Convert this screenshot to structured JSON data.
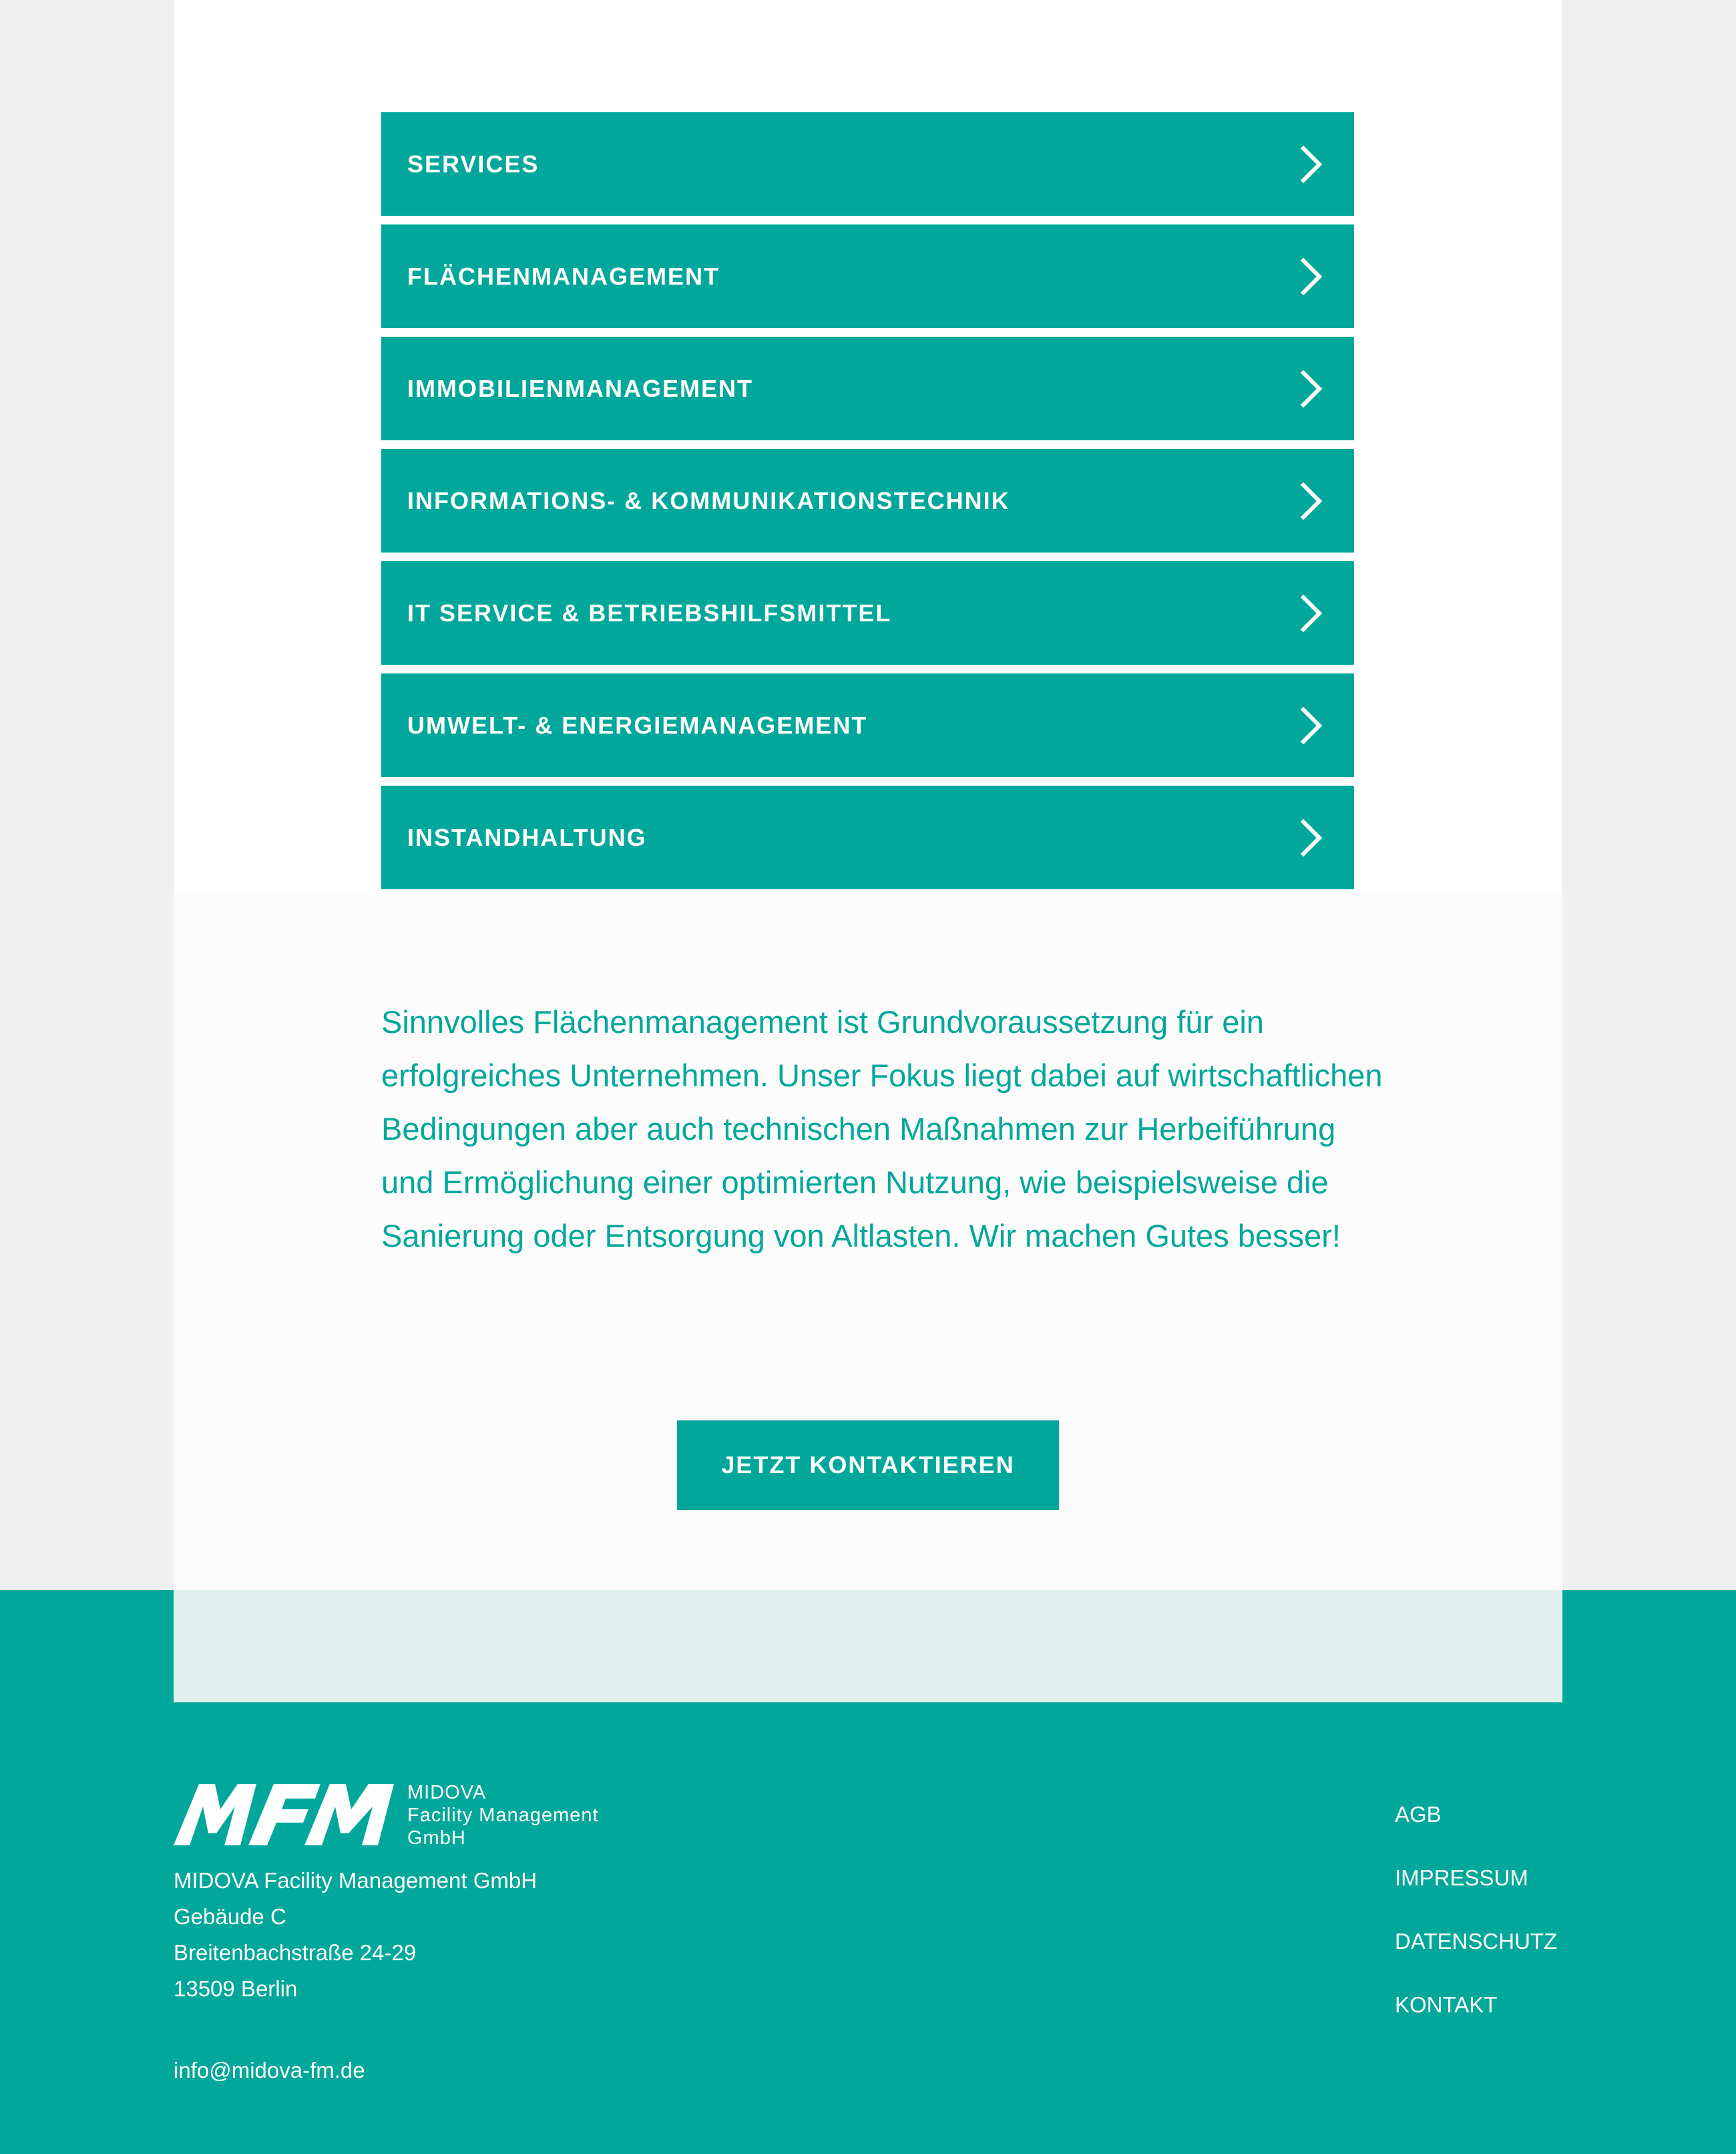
{
  "menu": {
    "items": [
      {
        "label": "SERVICES",
        "icon": "chevron-right-icon"
      },
      {
        "label": "FLÄCHENMANAGEMENT",
        "icon": "chevron-right-icon"
      },
      {
        "label": "IMMOBILIENMANAGEMENT",
        "icon": "chevron-right-icon"
      },
      {
        "label": "INFORMATIONS- & KOMMUNIKATIONSTECHNIK",
        "icon": "chevron-right-icon"
      },
      {
        "label": "IT SERVICE & BETRIEBSHILFSMITTEL",
        "icon": "chevron-right-icon"
      },
      {
        "label": "UMWELT- & ENERGIEMANAGEMENT",
        "icon": "chevron-right-icon"
      },
      {
        "label": "INSTANDHALTUNG",
        "icon": "chevron-right-icon"
      }
    ]
  },
  "intro": {
    "text": "Sinnvolles Flächenmanagement ist Grundvoraussetzung für ein erfolgreiches Unternehmen. Unser Fokus liegt dabei auf wirtschaftlichen Bedingungen aber auch technischen Maßnahmen zur Herbeiführung und Ermöglichung einer optimierten Nutzung, wie beispielsweise die Sanierung oder Entsorgung von Altlasten. Wir machen Gutes besser!",
    "cta_label": "JETZT KONTAKTIEREN"
  },
  "footer": {
    "logo": {
      "mark": "MFM",
      "line1": "MIDOVA",
      "line2": "Facility Management",
      "line3": "GmbH"
    },
    "address": {
      "company": "MIDOVA Facility Management GmbH",
      "building": "Gebäude C",
      "street": "Breitenbachstraße 24-29",
      "city": "13509 Berlin"
    },
    "email": "info@midova-fm.de",
    "links": [
      "AGB",
      "IMPRESSUM",
      "DATENSCHUTZ",
      "KONTAKT"
    ]
  },
  "colors": {
    "accent": "#00a79a",
    "background": "#efefef",
    "content_white": "#ffffff",
    "intro_bg": "#fbfbfb",
    "footer_band": "#e1f0ee"
  }
}
